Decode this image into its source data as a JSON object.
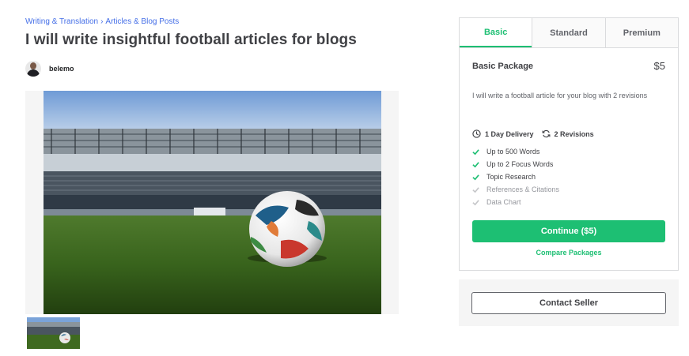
{
  "breadcrumb": {
    "category": "Writing & Translation",
    "separator": "›",
    "subcategory": "Articles & Blog Posts"
  },
  "gig": {
    "title": "I will write insightful football articles for blogs"
  },
  "seller": {
    "name": "belemo"
  },
  "gallery": {
    "main_image": "football-on-stadium-pitch",
    "thumbnail_count": 1
  },
  "package_card": {
    "tabs": [
      {
        "label": "Basic",
        "active": true
      },
      {
        "label": "Standard",
        "active": false
      },
      {
        "label": "Premium",
        "active": false
      }
    ],
    "package_name": "Basic Package",
    "price": "$5",
    "description": "I will write a football article for your blog with 2 revisions",
    "delivery": "1 Day Delivery",
    "revisions": "2 Revisions",
    "features": [
      {
        "label": "Up to 500 Words",
        "included": true
      },
      {
        "label": "Up to 2 Focus Words",
        "included": true
      },
      {
        "label": "Topic Research",
        "included": true
      },
      {
        "label": "References & Citations",
        "included": false
      },
      {
        "label": "Data Chart",
        "included": false
      }
    ],
    "continue_label": "Continue ($5)",
    "compare_label": "Compare Packages"
  },
  "contact": {
    "label": "Contact Seller"
  },
  "colors": {
    "accent": "#1dbf73",
    "link": "#446ee7",
    "text": "#404145",
    "muted": "#95979d",
    "border": "#dadbdd"
  },
  "icons": {
    "delivery": "clock-icon",
    "revisions": "refresh-icon",
    "feature": "check-icon"
  }
}
